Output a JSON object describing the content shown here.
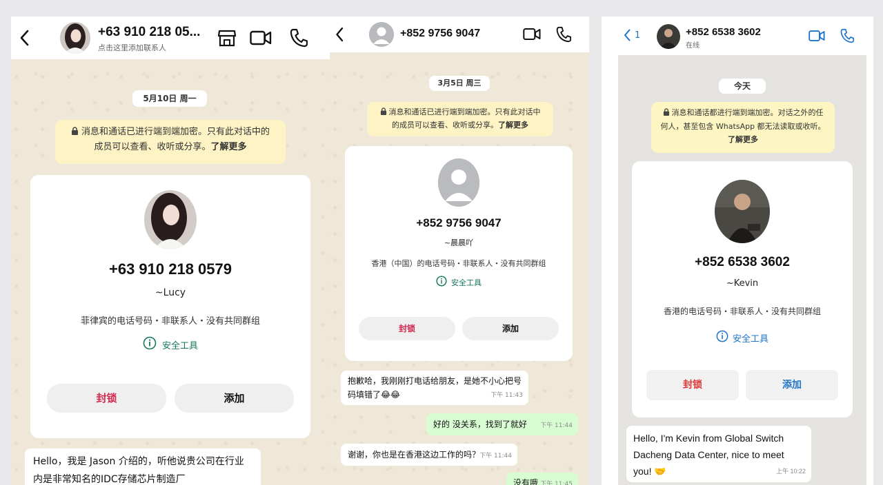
{
  "panel1": {
    "header": {
      "name": "+63 910 218 05...",
      "subtitle": "点击这里添加联系人"
    },
    "date": "5月10日 周一",
    "encryption": {
      "text": "消息和通话已进行端到端加密。只有此对话中的成员可以查看、收听或分享。",
      "link": "了解更多"
    },
    "card": {
      "phone": "+63 910 218 0579",
      "name": "~Lucy",
      "description": "菲律宾的电话号码・非联系人・没有共同群组",
      "safety": "安全工具",
      "block": "封锁",
      "add": "添加"
    },
    "message": {
      "text": "Hello，我是 Jason 介绍的，听他说贵公司在行业内是非常知名的IDC存储芯片制造厂"
    }
  },
  "panel2": {
    "header": {
      "name": "+852 9756 9047"
    },
    "date": "3月5日 周三",
    "encryption": {
      "text": "消息和通话已进行端到端加密。只有此对话中的成员可以查看、收听或分享。",
      "link": "了解更多"
    },
    "card": {
      "phone": "+852 9756 9047",
      "name": "~晨晨吖",
      "description": "香港（中国）的电话号码・非联系人・没有共同群组",
      "safety": "安全工具",
      "block": "封锁",
      "add": "添加"
    },
    "messages": [
      {
        "text": "抱歉哈，我刚刚打电话给朋友，是她不小心把号码填错了😂😂",
        "time": "下午 11:43",
        "dir": "in"
      },
      {
        "text": "好的 没关系，找到了就好",
        "time": "下午 11:44",
        "dir": "out"
      },
      {
        "text": "谢谢，你也是在香港这边工作的吗？",
        "time": "下午 11:44",
        "dir": "in"
      },
      {
        "text": "没有哦",
        "time": "下午 11:45",
        "dir": "out"
      }
    ]
  },
  "panel3": {
    "header": {
      "back_count": "1",
      "name": "+852 6538 3602",
      "subtitle": "在线"
    },
    "date": "今天",
    "encryption": {
      "text": "消息和通话都进行端到端加密。对话之外的任何人，甚至包含 WhatsApp 都无法读取或收听。",
      "link": "了解更多"
    },
    "card": {
      "phone": "+852 6538 3602",
      "name": "~Kevin",
      "description": "香港的电话号码・非联系人・没有共同群组",
      "safety": "安全工具",
      "block": "封锁",
      "add": "添加"
    },
    "message": {
      "text": "Hello, I'm Kevin from Global Switch Dacheng Data Center, nice to meet you! 🤝",
      "time": "上午 10:22"
    }
  },
  "colors": {
    "block": "#d22a4f",
    "add_blue": "#1d74c9",
    "enc_bg": "#fdf3c4",
    "out_bubble": "#d9fdd3",
    "chat_bg": "#efe7d8"
  },
  "icons": [
    "back-icon",
    "store-icon",
    "video-call-icon",
    "voice-call-icon",
    "lock-icon",
    "info-icon",
    "default-avatar-icon"
  ]
}
